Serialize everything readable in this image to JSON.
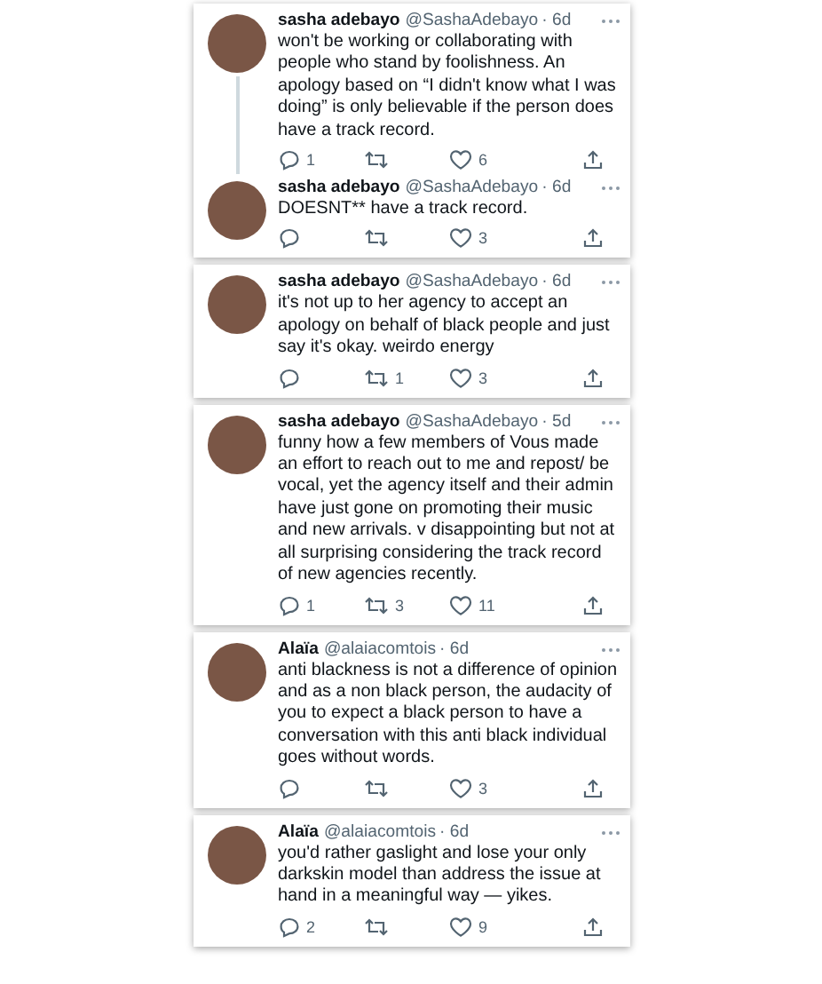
{
  "cards": [
    {
      "tweets": [
        {
          "name": "sasha adebayo",
          "handle": "@SashaAdebayo",
          "time": "· 6d",
          "text": "won't be working or collaborating with people who stand by foolishness. An apology based on “I didn't know what I was doing” is only believable if the person does have a track record.",
          "replies": "1",
          "likes": "6"
        },
        {
          "name": "sasha adebayo",
          "handle": "@SashaAdebayo",
          "time": "· 6d",
          "text": "DOESNT** have a track record.",
          "likes": "3"
        }
      ]
    },
    {
      "tweets": [
        {
          "name": "sasha adebayo",
          "handle": "@SashaAdebayo",
          "time": "· 6d",
          "text": "it's not up to her agency to accept an apology on behalf of black people and just say it's okay. weirdo energy",
          "retweets": "1",
          "likes": "3"
        }
      ]
    },
    {
      "tweets": [
        {
          "name": "sasha adebayo",
          "handle": "@SashaAdebayo",
          "time": "· 5d",
          "text": "funny how a few members of Vous made an effort to reach out to me and repost/ be vocal, yet the agency itself and their admin have just gone on promoting their music and new arrivals. v disappointing but not at all surprising considering the track record of new agencies recently.",
          "replies": "1",
          "retweets": "3",
          "likes": "11"
        }
      ]
    },
    {
      "tweets": [
        {
          "name": "Alaïa",
          "handle": "@alaiacomtois",
          "time": "· 6d",
          "text": "anti blackness is not a difference of opinion and as a non black person, the audacity of you to expect a black person to have a conversation with this anti black individual goes without words.",
          "likes": "3"
        }
      ]
    },
    {
      "tweets": [
        {
          "name": "Alaïa",
          "handle": "@alaiacomtois",
          "time": "· 6d",
          "text": "you'd rather gaslight and lose your only darkskin model than address the issue at hand in a meaningful way — yikes.",
          "replies": "2",
          "likes": "9"
        }
      ]
    }
  ]
}
